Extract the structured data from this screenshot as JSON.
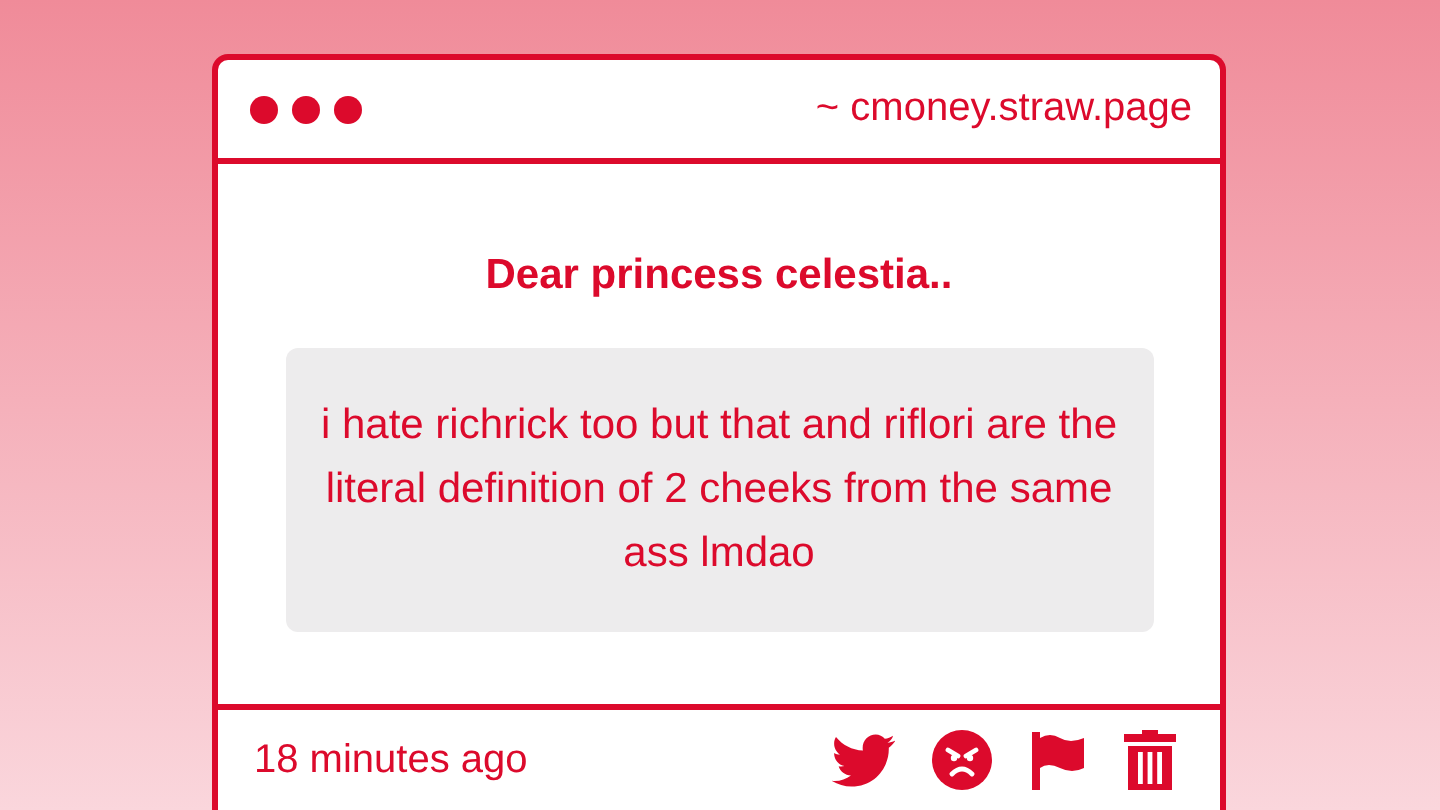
{
  "header": {
    "site": "~ cmoney.straw.page"
  },
  "message": {
    "title": "Dear princess celestia..",
    "body": "i hate richrick too but that and riflori are the literal definition of 2 cheeks from the same ass lmdao"
  },
  "footer": {
    "time": "18 minutes ago"
  }
}
